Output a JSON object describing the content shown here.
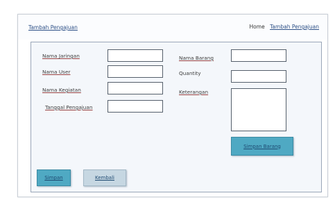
{
  "header": {
    "page_title": "Tambah Pengajuan",
    "nav": {
      "home_label": "Home",
      "current_label": "Tambah Pengajuan"
    }
  },
  "form": {
    "nama_jaringan_label": "Nama Jaringan",
    "nama_user_label": "Nama User",
    "nama_kegiatan_label": "Nama Kegiatan",
    "tanggal_pengajuan_label": "Tanggal Pengajuan",
    "nama_barang_label": "Nama Barang",
    "quantity_label": "Quantity",
    "keterangan_label": "Keterangan",
    "nama_jaringan_value": "",
    "nama_user_value": "",
    "nama_kegiatan_value": "",
    "tanggal_pengajuan_value": "",
    "nama_barang_value": "",
    "quantity_value": "",
    "keterangan_value": ""
  },
  "buttons": {
    "simpan_barang_label": "Simpan Barang",
    "simpan_label": "Simpan",
    "kembali_label": "Kembali"
  },
  "colors": {
    "primary_button": "#4fa9c3",
    "secondary_button": "#c6d7e2",
    "link": "#2c4f86"
  }
}
